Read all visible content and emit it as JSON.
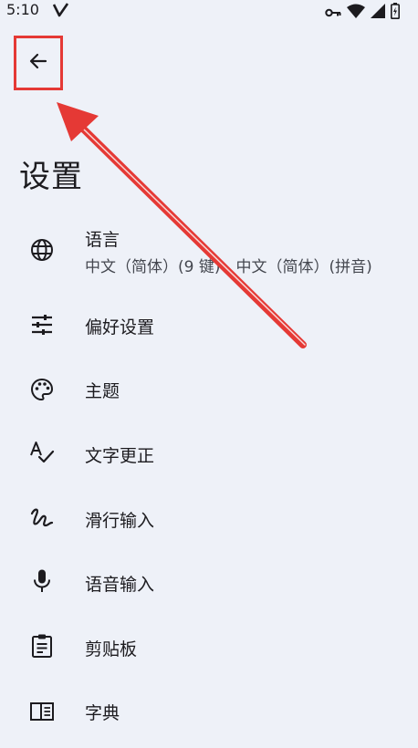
{
  "status_bar": {
    "time": "5:10",
    "icons": [
      "v-icon",
      "key-icon",
      "wifi-icon",
      "signal-icon",
      "battery-icon"
    ]
  },
  "header": {
    "back_icon": "arrow-back-icon",
    "title": "设置"
  },
  "settings": {
    "items": [
      {
        "label": "语言",
        "sublabel": "中文（简体）(9 键)、中文（简体）(拼音)",
        "icon": "globe-icon"
      },
      {
        "label": "偏好设置",
        "icon": "tune-icon"
      },
      {
        "label": "主题",
        "icon": "palette-icon"
      },
      {
        "label": "文字更正",
        "icon": "spellcheck-icon"
      },
      {
        "label": "滑行输入",
        "icon": "gesture-icon"
      },
      {
        "label": "语音输入",
        "icon": "mic-icon"
      },
      {
        "label": "剪贴板",
        "icon": "clipboard-icon"
      },
      {
        "label": "字典",
        "icon": "dictionary-icon"
      }
    ]
  },
  "annotation": {
    "color": "#e53935"
  }
}
